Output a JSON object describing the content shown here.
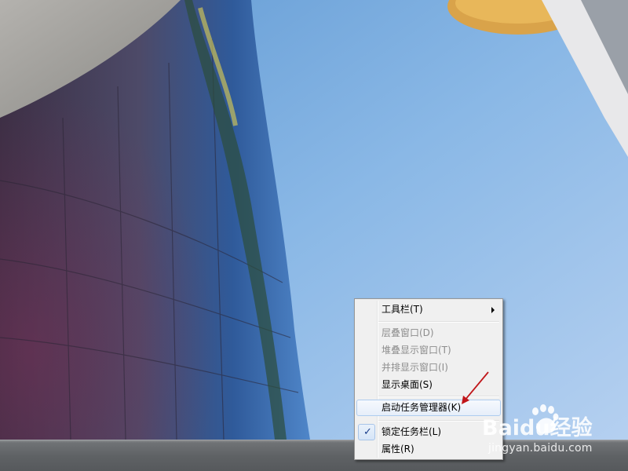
{
  "menu": {
    "items": [
      {
        "label": "工具栏(T)",
        "disabled": false,
        "submenu": true
      },
      {
        "label": "层叠窗口(D)",
        "disabled": true
      },
      {
        "label": "堆叠显示窗口(T)",
        "disabled": true
      },
      {
        "label": "并排显示窗口(I)",
        "disabled": true
      },
      {
        "label": "显示桌面(S)",
        "disabled": false
      },
      {
        "label": "启动任务管理器(K)",
        "disabled": false,
        "highlighted": true
      },
      {
        "label": "锁定任务栏(L)",
        "disabled": false,
        "checked": true
      },
      {
        "label": "属性(R)",
        "disabled": false
      }
    ],
    "check_glyph": "✓"
  },
  "watermark": {
    "brand": "Baidu经验",
    "url": "jingyan.baidu.com"
  },
  "colors": {
    "menu_background": "#f0f0f0",
    "highlight_border": "#aeccef",
    "annotation_arrow": "#c0161a",
    "sky": "#8fbbe6"
  },
  "icons": {
    "submenu": "chevron-right-icon",
    "check": "check-icon",
    "annotation": "red-arrow-icon",
    "watermark_logo": "paw-logo"
  }
}
